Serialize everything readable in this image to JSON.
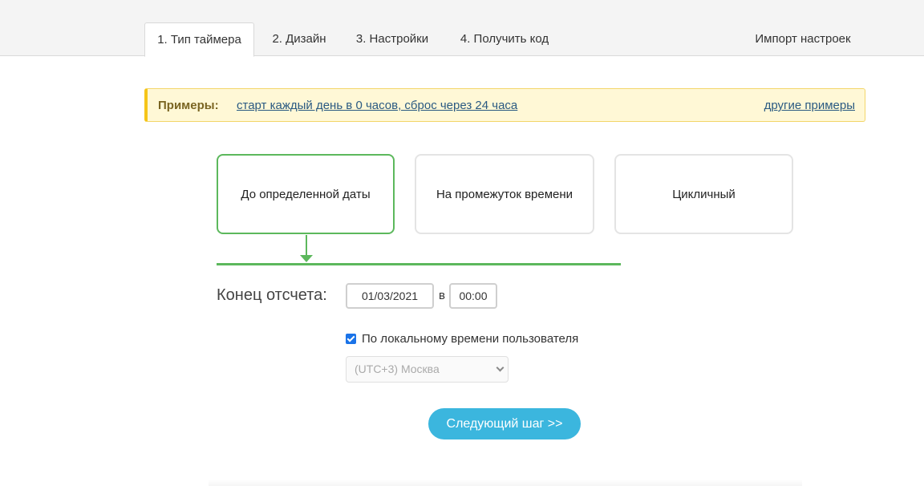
{
  "tabs": {
    "tab1": "1. Тип таймера",
    "tab2": "2. Дизайн",
    "tab3": "3. Настройки",
    "tab4": "4. Получить код",
    "import": "Импорт настроек"
  },
  "examples": {
    "label": "Примеры:",
    "link1": "старт каждый день в 0 часов, сброс через 24 часа",
    "more": "другие примеры"
  },
  "timer_types": {
    "card1": "До определенной даты",
    "card2": "На промежуток времени",
    "card3": "Цикличный"
  },
  "end": {
    "label": "Конец отсчета:",
    "date": "01/03/2021",
    "at": "в",
    "time": "00:00"
  },
  "local_time": {
    "checked": true,
    "label": "По локальному времени пользователя"
  },
  "timezone": {
    "selected": "(UTC+3) Москва"
  },
  "next_button": "Следующий шаг >>",
  "colors": {
    "accent_green": "#5cb85c",
    "button_blue": "#3bb6de",
    "banner_yellow": "#fff8d6",
    "checkbox_blue": "#1a73e8"
  }
}
